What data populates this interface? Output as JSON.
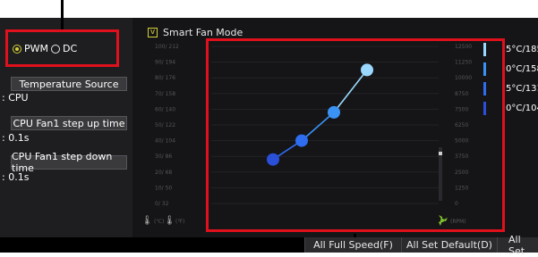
{
  "mode": {
    "pwm_label": "PWM",
    "dc_label": "DC",
    "selected": "PWM"
  },
  "temperature_source": {
    "button_label": "Temperature Source",
    "value": ": CPU"
  },
  "step_up": {
    "button_label": "CPU Fan1 step up time",
    "value": ": 0.1s"
  },
  "step_down": {
    "button_label": "CPU Fan1 step down time",
    "value": ": 0.1s"
  },
  "smart_fan": {
    "label": "Smart Fan Mode",
    "checked": true
  },
  "axes": {
    "temp_ticks": [
      "100/ 212",
      "90/ 194",
      "80/ 176",
      "70/ 158",
      "60/ 140",
      "50/ 122",
      "40/ 104",
      "30/ 86",
      "20/ 68",
      "10/ 50",
      "0/ 32"
    ],
    "rpm_ticks": [
      "12500",
      "11250",
      "10000",
      "8750",
      "7500",
      "6250",
      "5000",
      "3750",
      "2500",
      "1250",
      "0"
    ],
    "temp_unit_c": "(℃)",
    "temp_unit_f": "(℉)",
    "rpm_unit": "(RPM)"
  },
  "curve_points": [
    {
      "temp_c": 21.5,
      "rpm_pct": 28
    },
    {
      "temp_c": 37.5,
      "rpm_pct": 40
    },
    {
      "temp_c": 55.5,
      "rpm_pct": 58
    },
    {
      "temp_c": 74,
      "rpm_pct": 85
    }
  ],
  "curve_colors": [
    "#2a4fd8",
    "#2e6cf0",
    "#3a92f5",
    "#9ad8ff"
  ],
  "sensors": [
    "5°C/185",
    "0°C/158",
    "5°C/131",
    "0°C/104"
  ],
  "bottom_buttons": [
    "All Full Speed(F)",
    "All Set Default(D)",
    "All Set"
  ],
  "colors": {
    "highlight": "#e0101c",
    "accent": "#d4d03a"
  }
}
